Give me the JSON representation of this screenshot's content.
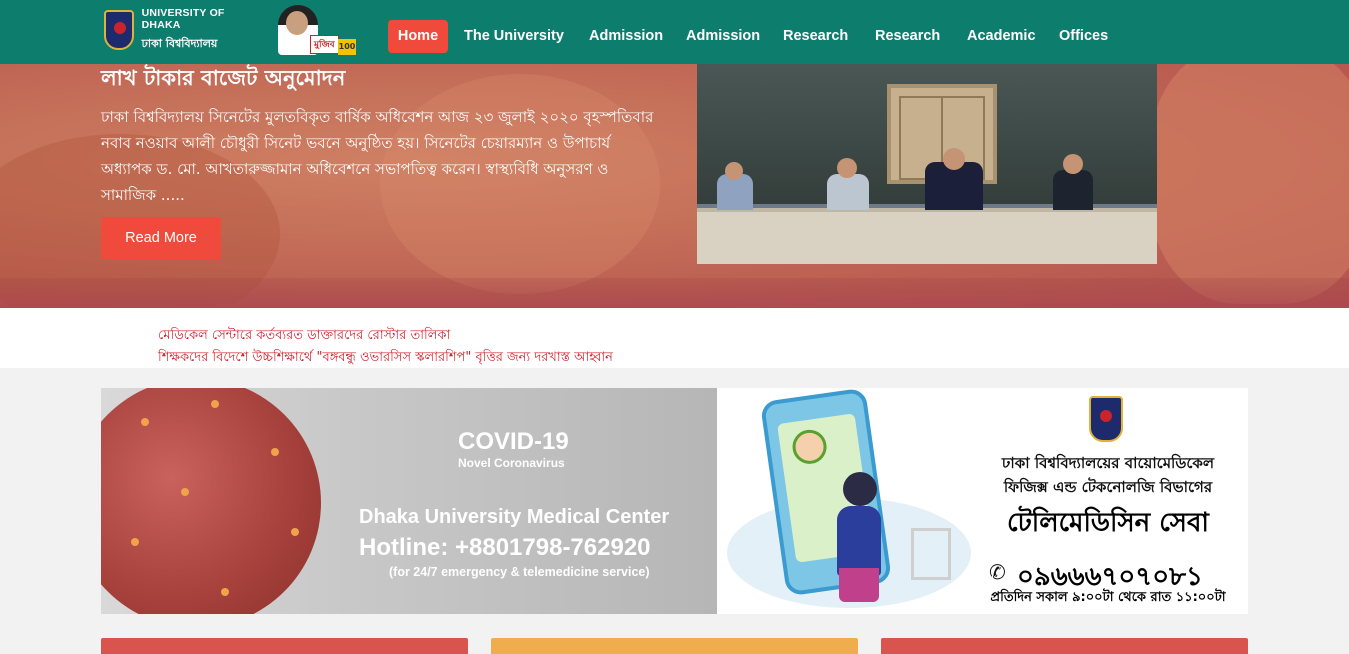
{
  "header": {
    "logo": {
      "name_en": "UNIVERSITY OF DHAKA",
      "name_bn": "ঢাকা বিশ্ববিদ্যালয়"
    },
    "mujib_logo": {
      "tag": "মুজিব",
      "number": "100"
    },
    "nav": [
      {
        "label": "Home",
        "active": true
      },
      {
        "label": "The University"
      },
      {
        "label": "Admission"
      },
      {
        "label": "Admission"
      },
      {
        "label": "Research"
      },
      {
        "label": "Research"
      },
      {
        "label": "Academic"
      },
      {
        "label": "Offices"
      }
    ],
    "colors": {
      "bar": "#0d7d6e",
      "active": "#ef4a3b"
    }
  },
  "hero": {
    "title": "লাখ টাকার বাজেট অনুমোদন",
    "body": "ঢাকা বিশ্ববিদ্যালয় সিনেটের মুলতবিকৃত বার্ষিক অধিবেশন আজ ২৩ জুলাই ২০২০ বৃহস্পতিবার নবাব নওয়াব আলী চৌধুরী সিনেট ভবনে অনুষ্ঠিত হয়। সিনেটের চেয়ারম্যান ও উপাচার্য অধ্যাপক ড. মো. আখতারুজ্জামান অধিবেশনে সভাপতিত্ব করেন। স্বাস্থ্যবিধি অনুসরণ ও সামাজিক .....",
    "read_more": "Read More"
  },
  "notices": [
    "মেডিকেল সেন্টারে কর্তব্যরত ডাক্তারদের রোস্টার তালিকা",
    "শিক্ষকদের বিদেশে উচ্চশিক্ষার্থে \"বঙ্গবন্ধু ওভারসিস স্কলারশিপ\" বৃত্তির জন্য দরখাস্ত আহ্বান"
  ],
  "covid_banner": {
    "title": "COVID-19",
    "subtitle": "Novel Coronavirus",
    "center": "Dhaka University Medical Center",
    "hotline": "Hotline: +8801798-762920",
    "note": "(for 24/7 emergency & telemedicine service)"
  },
  "tele_banner": {
    "line1": "ঢাকা বিশ্ববিদ্যালয়ের বায়োমেডিকেল",
    "line2": "ফিজিক্স এন্ড টেকনোলজি বিভাগের",
    "line3": "টেলিমেডিসিন সেবা",
    "number": "০৯৬৬৬৭০৭০৮১",
    "hours": "প্রতিদিন সকাল ৯:০০টা থেকে রাত ১১:০০টা",
    "phone_icon": "phone-icon"
  },
  "cards": [
    {
      "color": "#d9534f"
    },
    {
      "color": "#f0ad4e"
    },
    {
      "color": "#d9534f"
    }
  ]
}
